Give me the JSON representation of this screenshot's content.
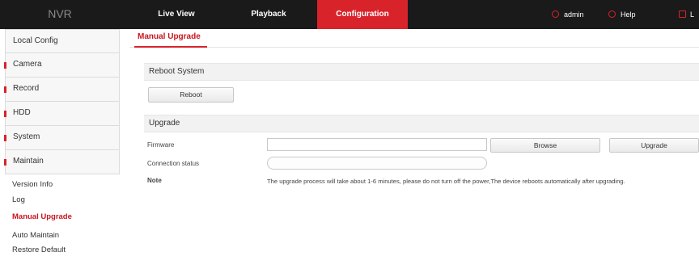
{
  "header": {
    "logo": "NVR",
    "tabs": [
      {
        "label": "Live View"
      },
      {
        "label": "Playback"
      },
      {
        "label": "Configuration"
      }
    ],
    "user": "admin",
    "help": "Help",
    "logout": "L"
  },
  "sidebar": {
    "menu": [
      {
        "label": "Local Config"
      },
      {
        "label": "Camera"
      },
      {
        "label": "Record"
      },
      {
        "label": "HDD"
      },
      {
        "label": "System"
      },
      {
        "label": "Maintain"
      }
    ],
    "submenu": [
      {
        "label": "Version Info"
      },
      {
        "label": "Log"
      },
      {
        "label": "Manual Upgrade"
      },
      {
        "label": "Auto Maintain"
      },
      {
        "label": "Restore Default"
      }
    ]
  },
  "page": {
    "breadcrumb": "Manual Upgrade",
    "reboot_section": "Reboot System",
    "reboot_button": "Reboot",
    "upgrade_section": "Upgrade",
    "firmware_label": "Firmware",
    "firmware_value": "",
    "browse_button": "Browse",
    "upgrade_button": "Upgrade",
    "status_label": "Connection status",
    "status_value": "",
    "note_label": "Note",
    "note_text": "The upgrade process will take about 1-6 minutes, please do not turn off the power,The device reboots automatically after upgrading."
  },
  "colors": {
    "accent": "#d8232a",
    "topbar": "#1a1a1a"
  }
}
